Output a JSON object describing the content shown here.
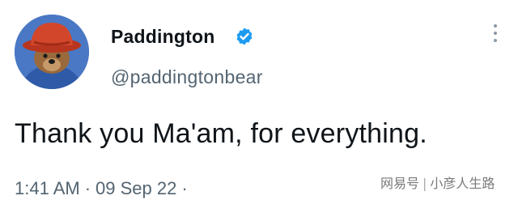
{
  "tweet": {
    "display_name": "Paddington",
    "handle": "@paddingtonbear",
    "verified": true,
    "avatar_icon": "paddington-bear-avatar",
    "text": "Thank you Ma'am, for everything.",
    "time": "1:41 AM",
    "separator": "·",
    "date": "09 Sep 22",
    "trailing_separator": "·"
  },
  "watermark": {
    "source": "网易号",
    "divider": "|",
    "author": "小彦人生路"
  },
  "colors": {
    "verified_blue": "#1d9bf0",
    "hat_red": "#d2472b",
    "coat_blue": "#3f6db8",
    "muted_text": "#536471"
  }
}
